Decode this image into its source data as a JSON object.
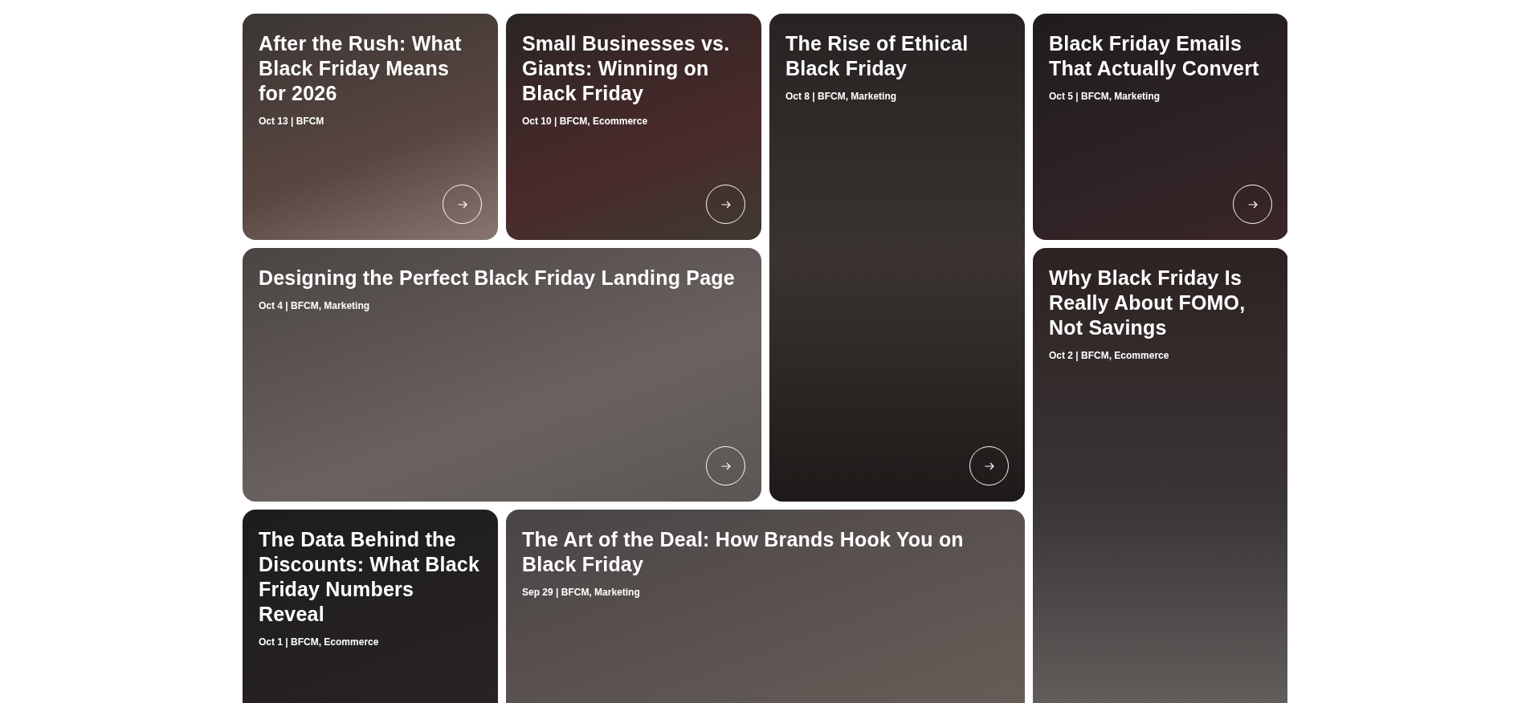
{
  "posts": [
    {
      "kind": "small",
      "title": "After the Rush: What Black Friday Means for 2026",
      "meta": "Oct 13 | BFCM",
      "arrow": true
    },
    {
      "kind": "small",
      "title": "Small Businesses vs. Giants: Winning on Black Friday",
      "meta": "Oct 10 | BFCM, Ecommerce",
      "arrow": true
    },
    {
      "kind": "tall",
      "title": "The Rise of Ethical Black Friday",
      "meta": "Oct 8 | BFCM, Marketing",
      "arrow": true
    },
    {
      "kind": "small",
      "title": "Black Friday Emails That Actually Convert",
      "meta": "Oct 5 | BFCM, Marketing",
      "arrow": true
    },
    {
      "kind": "wide",
      "title": "Designing the Perfect Black Friday Landing Page",
      "meta": "Oct 4 | BFCM, Marketing",
      "arrow": true
    },
    {
      "kind": "tall",
      "title": "Why Black Friday Is Really About FOMO, Not Savings",
      "meta": "Oct 2 | BFCM, Ecommerce",
      "arrow": false
    },
    {
      "kind": "small",
      "title": "The Data Behind the Discounts: What Black Friday Numbers Reveal",
      "meta": "Oct 1 | BFCM, Ecommerce",
      "arrow": false
    },
    {
      "kind": "wide",
      "title": "The Art of the Deal: How Brands Hook You on Black Friday",
      "meta": "Sep 29 | BFCM, Marketing",
      "arrow": false
    }
  ]
}
